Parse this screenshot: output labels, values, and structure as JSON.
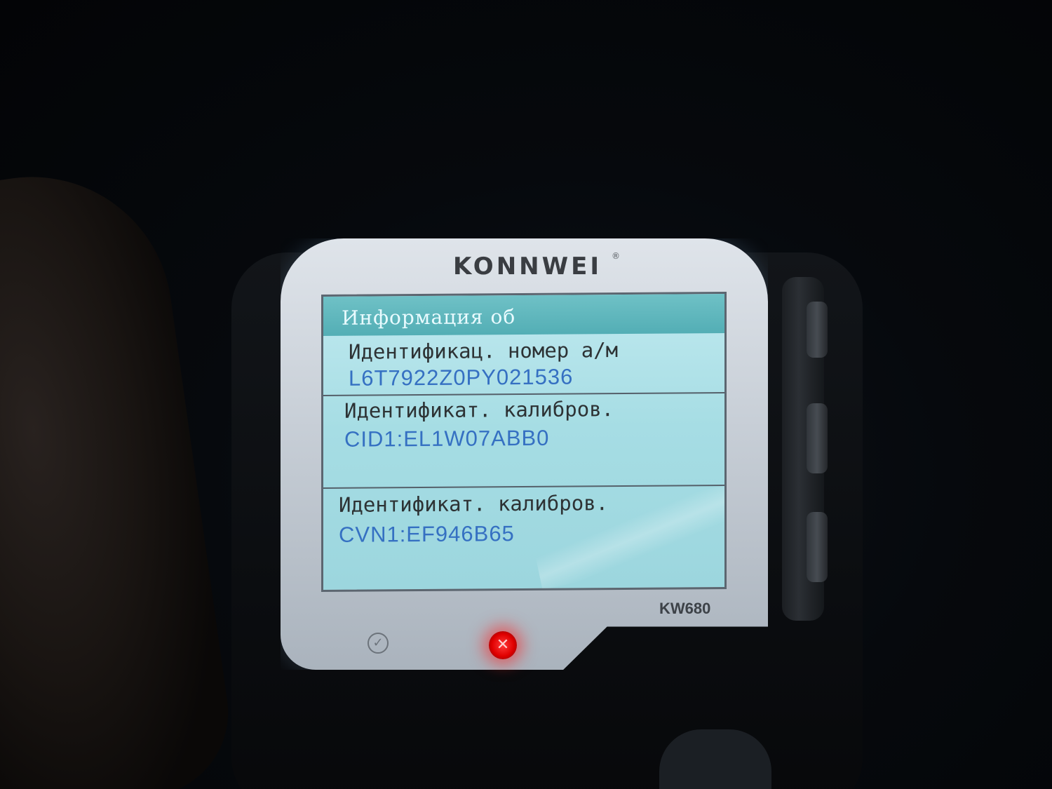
{
  "device": {
    "brand": "KONNWEI",
    "registered_mark": "®",
    "model": "KW680",
    "ok_icon": "checkmark-icon",
    "cancel_icon": "x-icon",
    "led_color": "#ff1a1a"
  },
  "screen": {
    "header": "Информация об",
    "rows": [
      {
        "label": "Идентификац. номер а/м",
        "value": "L6T7922Z0PY021536"
      },
      {
        "label": "Идентификат. калибров.",
        "value": "CID1:EL1W07ABB0"
      },
      {
        "label": "Идентификат. калибров.",
        "value": "CVN1:EF946B65"
      }
    ],
    "colors": {
      "background": "#a6dde4",
      "header": "#53aeb5",
      "label_text": "#2d3234",
      "value_text": "#3570c2"
    }
  }
}
